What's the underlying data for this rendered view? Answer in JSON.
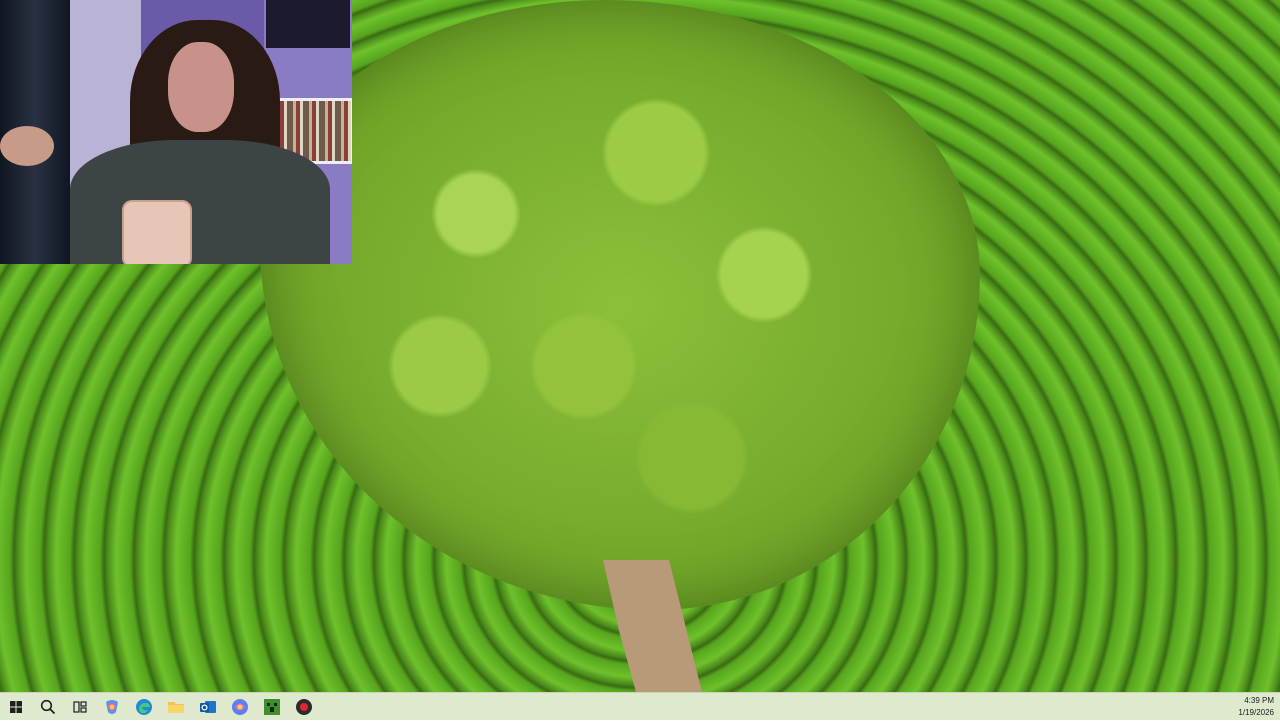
{
  "desktop": {
    "wallpaper": "aerial tree surrounded by tea field rows",
    "colors": {
      "field_light": "#6fc12b",
      "field_dark": "#3a6b12",
      "canopy": "#8cc03a",
      "path": "#b99a78"
    }
  },
  "webcam_overlay": {
    "description": "webcam feed of presenter holding phone"
  },
  "taskbar": {
    "background": "#dfe9ce",
    "icons": [
      {
        "name": "start-icon",
        "label": "Start"
      },
      {
        "name": "search-icon",
        "label": "Search"
      },
      {
        "name": "task-view-icon",
        "label": "Task View"
      },
      {
        "name": "copilot-icon",
        "label": "Copilot"
      },
      {
        "name": "edge-icon",
        "label": "Microsoft Edge"
      },
      {
        "name": "file-explorer-icon",
        "label": "File Explorer"
      },
      {
        "name": "outlook-icon",
        "label": "Outlook"
      },
      {
        "name": "copilot-365-icon",
        "label": "Microsoft 365 Copilot"
      },
      {
        "name": "minecraft-icon",
        "label": "Minecraft"
      },
      {
        "name": "recorder-icon",
        "label": "Recorder"
      }
    ],
    "clock": {
      "time": "4:39 PM",
      "date": "1/19/2026"
    }
  }
}
